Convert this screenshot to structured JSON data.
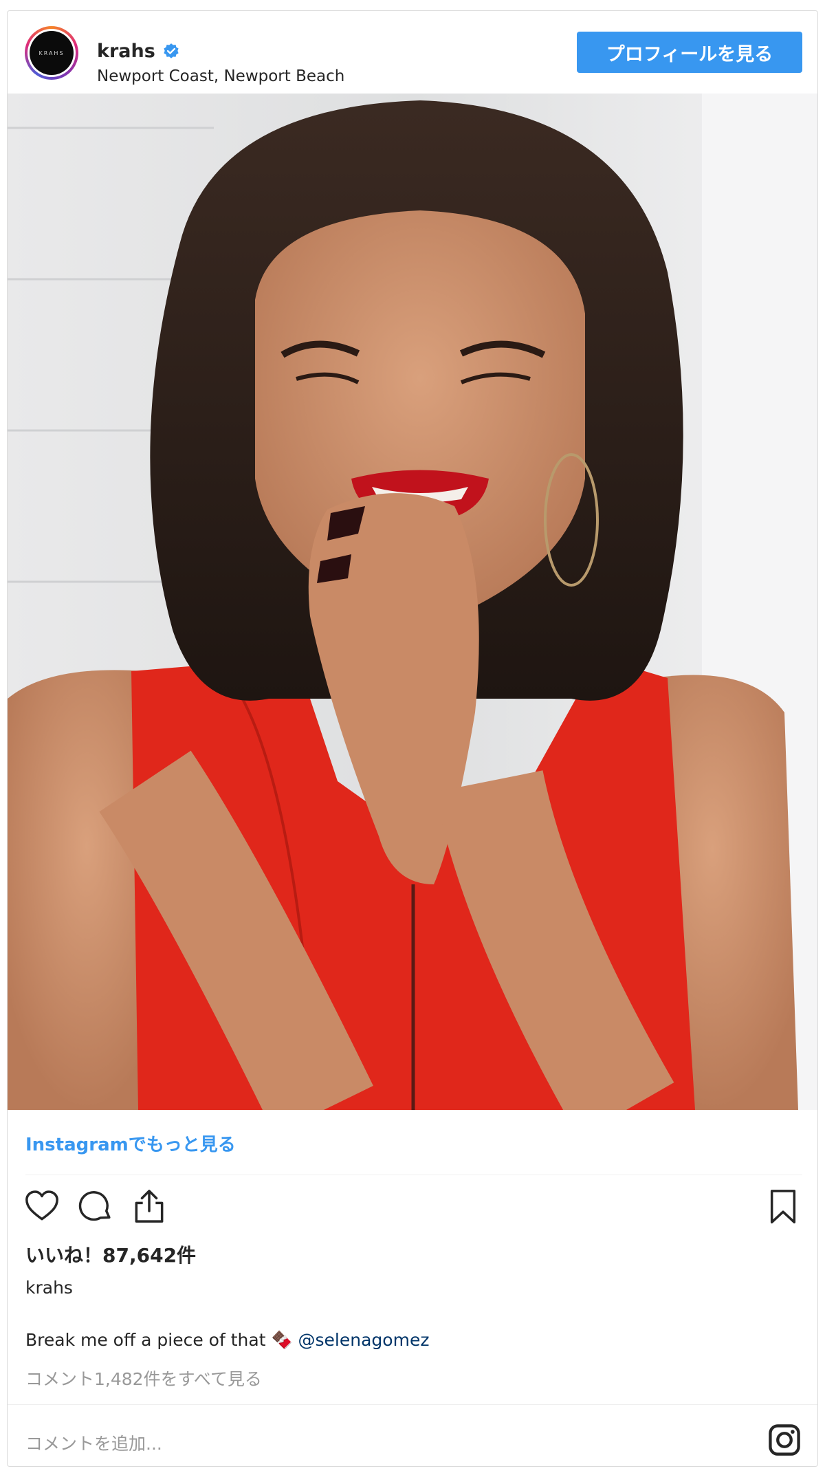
{
  "header": {
    "username": "krahs",
    "location": "Newport Coast, Newport Beach",
    "profile_button": "プロフィールを見る",
    "avatar_text": "KRAHS"
  },
  "more_link": "Instagramでもっと見る",
  "likes": "いいね！87,642件",
  "owner": "krahs",
  "caption": {
    "text": "Break me off a piece of that 🍫 ",
    "mention": "@selenagomez"
  },
  "view_comments": "コメント1,482件をすべて見る",
  "add_comment_placeholder": "コメントを追加...",
  "colors": {
    "accent": "#3897f0",
    "mention": "#003569",
    "muted": "#999999",
    "dress": "#e0271b"
  },
  "icons": [
    "verified-badge-icon",
    "heart-icon",
    "comment-icon",
    "share-icon",
    "bookmark-icon",
    "instagram-icon"
  ]
}
